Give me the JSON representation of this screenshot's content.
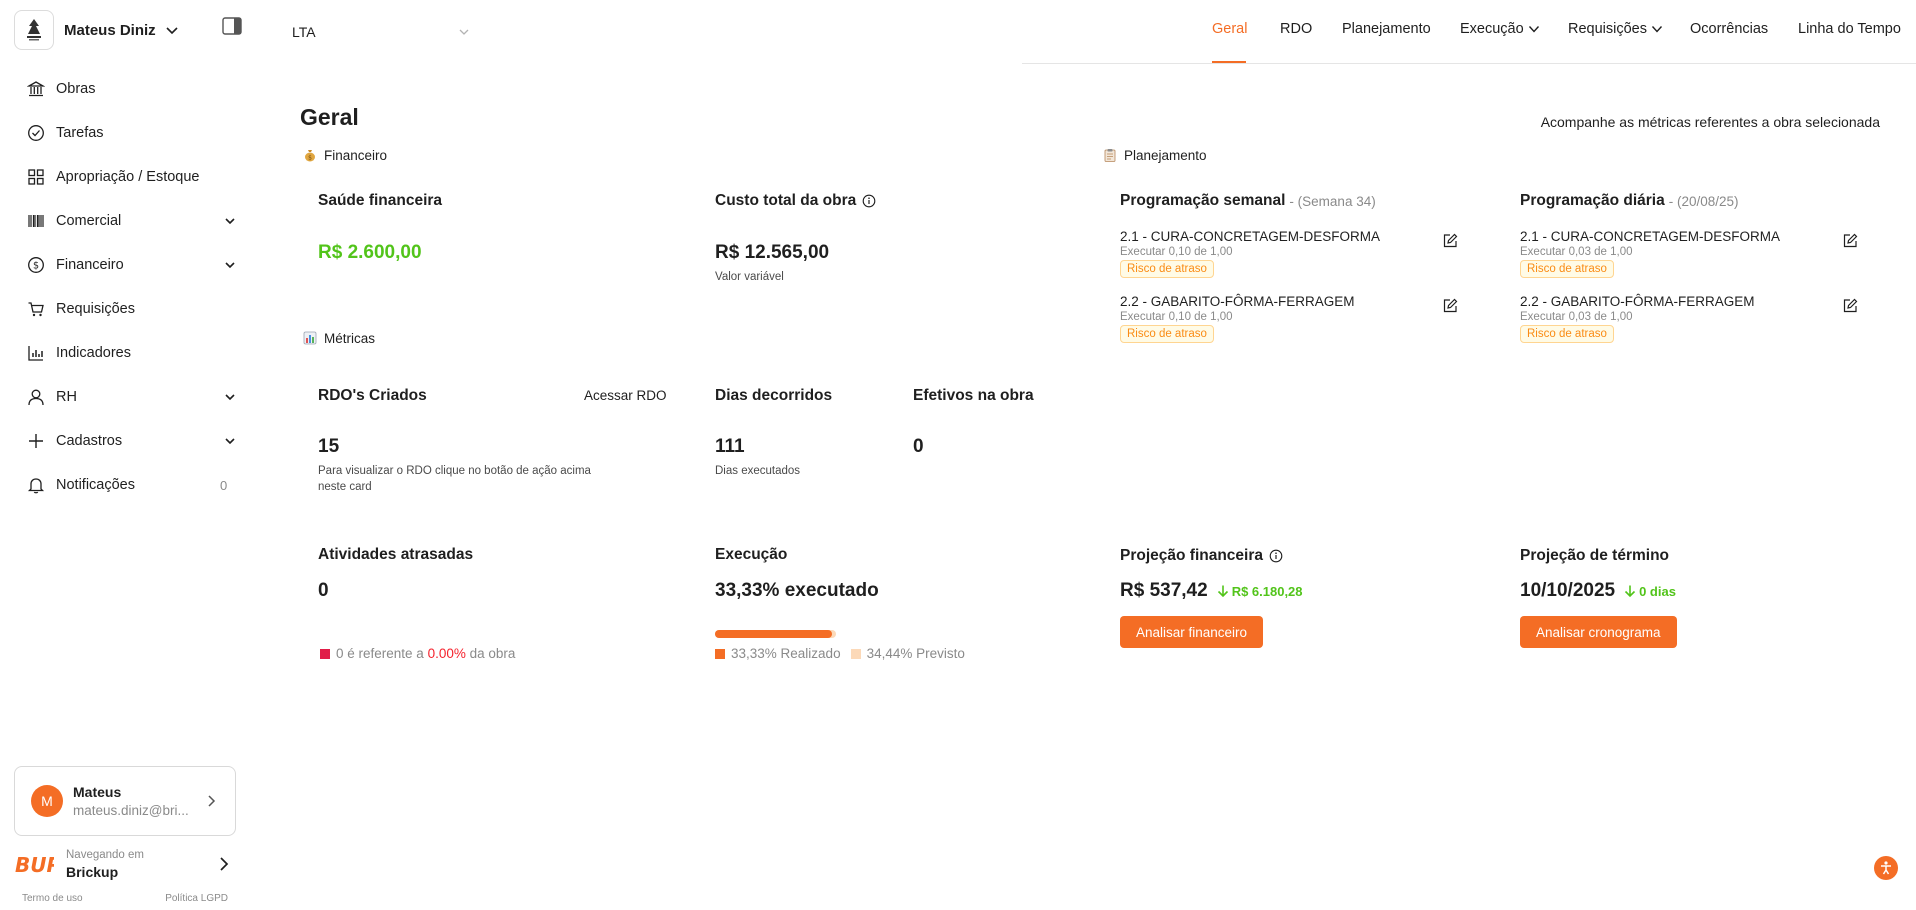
{
  "sidebar": {
    "brand_name": "Mateus Diniz",
    "items": [
      {
        "label": "Obras",
        "icon": "bank-icon",
        "has_chevron": false
      },
      {
        "label": "Tarefas",
        "icon": "check-circle-icon",
        "has_chevron": false
      },
      {
        "label": "Apropriação / Estoque",
        "icon": "grid-icon",
        "has_chevron": false
      },
      {
        "label": "Comercial",
        "icon": "barcode-icon",
        "has_chevron": true
      },
      {
        "label": "Financeiro",
        "icon": "dollar-circle-icon",
        "has_chevron": true
      },
      {
        "label": "Requisições",
        "icon": "cart-icon",
        "has_chevron": false
      },
      {
        "label": "Indicadores",
        "icon": "bar-chart-icon",
        "has_chevron": false
      },
      {
        "label": "RH",
        "icon": "user-icon",
        "has_chevron": true
      },
      {
        "label": "Cadastros",
        "icon": "plus-icon",
        "has_chevron": true
      },
      {
        "label": "Notificações",
        "icon": "bell-icon",
        "has_chevron": false,
        "count": "0"
      }
    ],
    "user": {
      "initial": "M",
      "name": "Mateus",
      "email": "mateus.diniz@bri..."
    },
    "org": {
      "caption": "Navegando em",
      "name": "Brickup"
    },
    "footer": {
      "terms": "Termo de uso",
      "privacy": "Política LGPD"
    }
  },
  "topbar": {
    "project": "LTA",
    "tabs": [
      {
        "label": "Geral",
        "active": true,
        "dropdown": false
      },
      {
        "label": "RDO",
        "active": false,
        "dropdown": false
      },
      {
        "label": "Planejamento",
        "active": false,
        "dropdown": false
      },
      {
        "label": "Execução",
        "active": false,
        "dropdown": true
      },
      {
        "label": "Requisições",
        "active": false,
        "dropdown": true
      },
      {
        "label": "Ocorrências",
        "active": false,
        "dropdown": false
      },
      {
        "label": "Linha do Tempo",
        "active": false,
        "dropdown": false
      }
    ]
  },
  "main": {
    "title": "Geral",
    "subtitle": "Acompanhe as métricas referentes a obra selecionada",
    "sections": {
      "financeiro": "Financeiro",
      "metricas": "Métricas",
      "planejamento": "Planejamento"
    },
    "saude": {
      "title": "Saúde financeira",
      "value": "R$ 2.600,00"
    },
    "custo": {
      "title": "Custo total da obra",
      "value": "R$ 12.565,00",
      "note": "Valor variável"
    },
    "rdo": {
      "title": "RDO's Criados",
      "action": "Acessar RDO",
      "value": "15",
      "note": "Para visualizar o RDO clique no botão de ação acima neste card"
    },
    "dias": {
      "title": "Dias decorridos",
      "value": "111",
      "note": "Dias executados"
    },
    "efetivos": {
      "title": "Efetivos na obra",
      "value": "0"
    },
    "atrasadas": {
      "title": "Atividades atrasadas",
      "value": "0",
      "legend_prefix": "0 é referente a",
      "legend_pct": "0.00%",
      "legend_suffix": "da obra"
    },
    "execucao": {
      "title": "Execução",
      "value": "33,33% executado",
      "progress": 0.3333,
      "planned": 0.3444,
      "realizado": "33,33% Realizado",
      "previsto": "34,44% Previsto"
    },
    "semanal": {
      "title": "Programação semanal",
      "period": "- (Semana 34)",
      "tasks": [
        {
          "title": "2.1 - CURA-CONCRETAGEM-DESFORMA",
          "sub": "Executar 0,10 de 1,00",
          "badge": "Risco de atraso"
        },
        {
          "title": "2.2 - GABARITO-FÔRMA-FERRAGEM",
          "sub": "Executar 0,10 de 1,00",
          "badge": "Risco de atraso"
        }
      ]
    },
    "diaria": {
      "title": "Programação diária",
      "period": "- (20/08/25)",
      "tasks": [
        {
          "title": "2.1 - CURA-CONCRETAGEM-DESFORMA",
          "sub": "Executar 0,03 de 1,00",
          "badge": "Risco de atraso"
        },
        {
          "title": "2.2 - GABARITO-FÔRMA-FERRAGEM",
          "sub": "Executar 0,03 de 1,00",
          "badge": "Risco de atraso"
        }
      ]
    },
    "projecao_fin": {
      "title": "Projeção financeira",
      "value": "R$ 537,42",
      "delta": "R$ 6.180,28",
      "button": "Analisar financeiro"
    },
    "projecao_ter": {
      "title": "Projeção de término",
      "value": "10/10/2025",
      "delta": "0 dias",
      "button": "Analisar cronograma"
    }
  },
  "colors": {
    "accent": "#f46d25",
    "positive": "#52c41a",
    "danger": "#f5222d",
    "warning": "#fa8c16"
  }
}
